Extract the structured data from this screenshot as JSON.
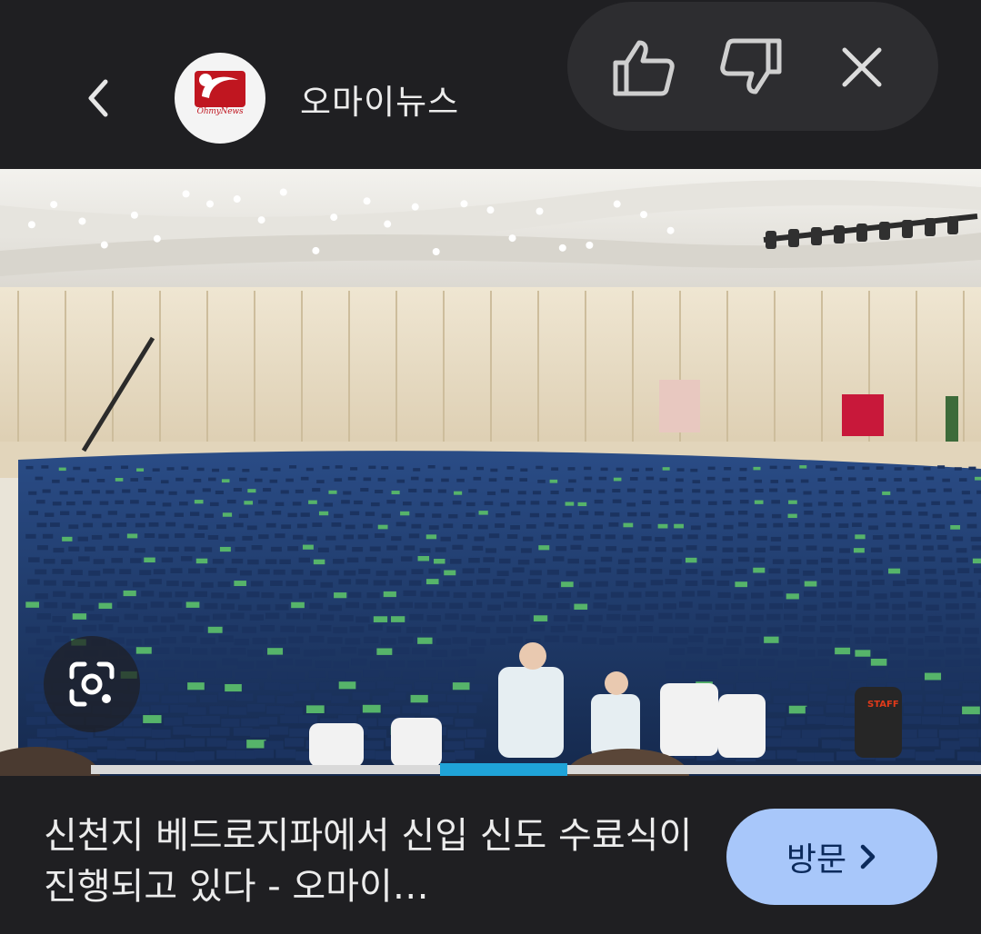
{
  "header": {
    "source_name": "오마이뉴스",
    "logo_text": "OhmyNews",
    "icons": {
      "back": "chevron-left-icon",
      "like": "thumbs-up-icon",
      "dislike": "thumbs-down-icon",
      "close": "close-icon"
    }
  },
  "image": {
    "badge_text": "STAFF",
    "lens_icon": "google-lens-icon"
  },
  "footer": {
    "caption": "신천지 베드로지파에서 신입 신도 수료식이 진행되고 있다 - 오마이…",
    "visit_label": "방문"
  },
  "colors": {
    "background": "#1f1f22",
    "pill": "#2d2d30",
    "visit_button": "#a8c7fa",
    "gown": "#1e3b6e",
    "logo_red": "#c01620"
  }
}
